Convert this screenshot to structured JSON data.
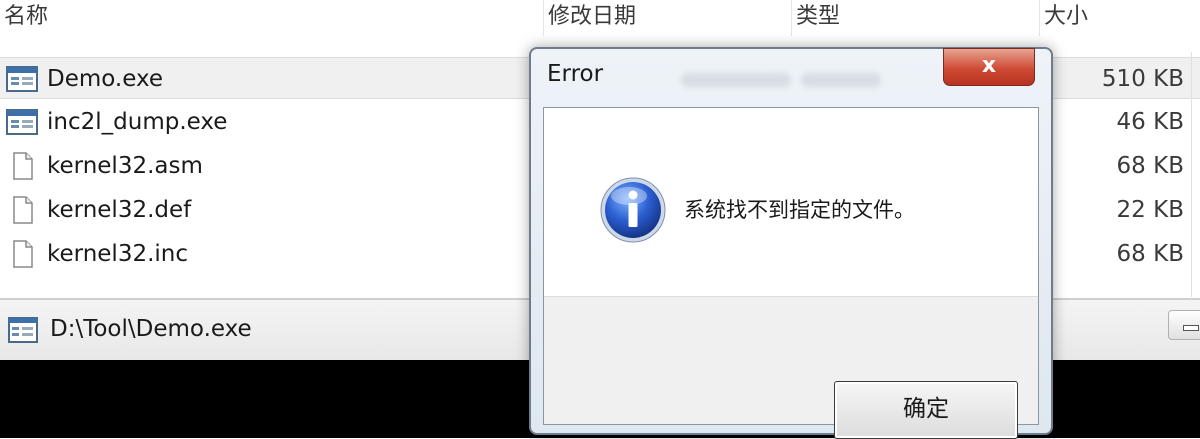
{
  "explorer": {
    "columns": {
      "name": "名称",
      "modified": "修改日期",
      "type": "类型",
      "size": "大小"
    },
    "files": [
      {
        "name": "Demo.exe",
        "size": "510 KB",
        "icon": "exe-window-icon",
        "selected": true
      },
      {
        "name": "inc2l_dump.exe",
        "size": "46 KB",
        "icon": "exe-window-icon",
        "selected": false
      },
      {
        "name": "kernel32.asm",
        "size": "68 KB",
        "icon": "document-icon",
        "selected": false
      },
      {
        "name": "kernel32.def",
        "size": "22 KB",
        "icon": "document-icon",
        "selected": false
      },
      {
        "name": "kernel32.inc",
        "size": "68 KB",
        "icon": "document-icon",
        "selected": false
      }
    ]
  },
  "console": {
    "title": "D:\\Tool\\Demo.exe",
    "icon": "console-window-icon"
  },
  "dialog": {
    "title": "Error",
    "close_label": "x",
    "message": "系统找不到指定的文件。",
    "icon": "info-icon",
    "ok_label": "确定",
    "accent": "#cf4b35"
  }
}
